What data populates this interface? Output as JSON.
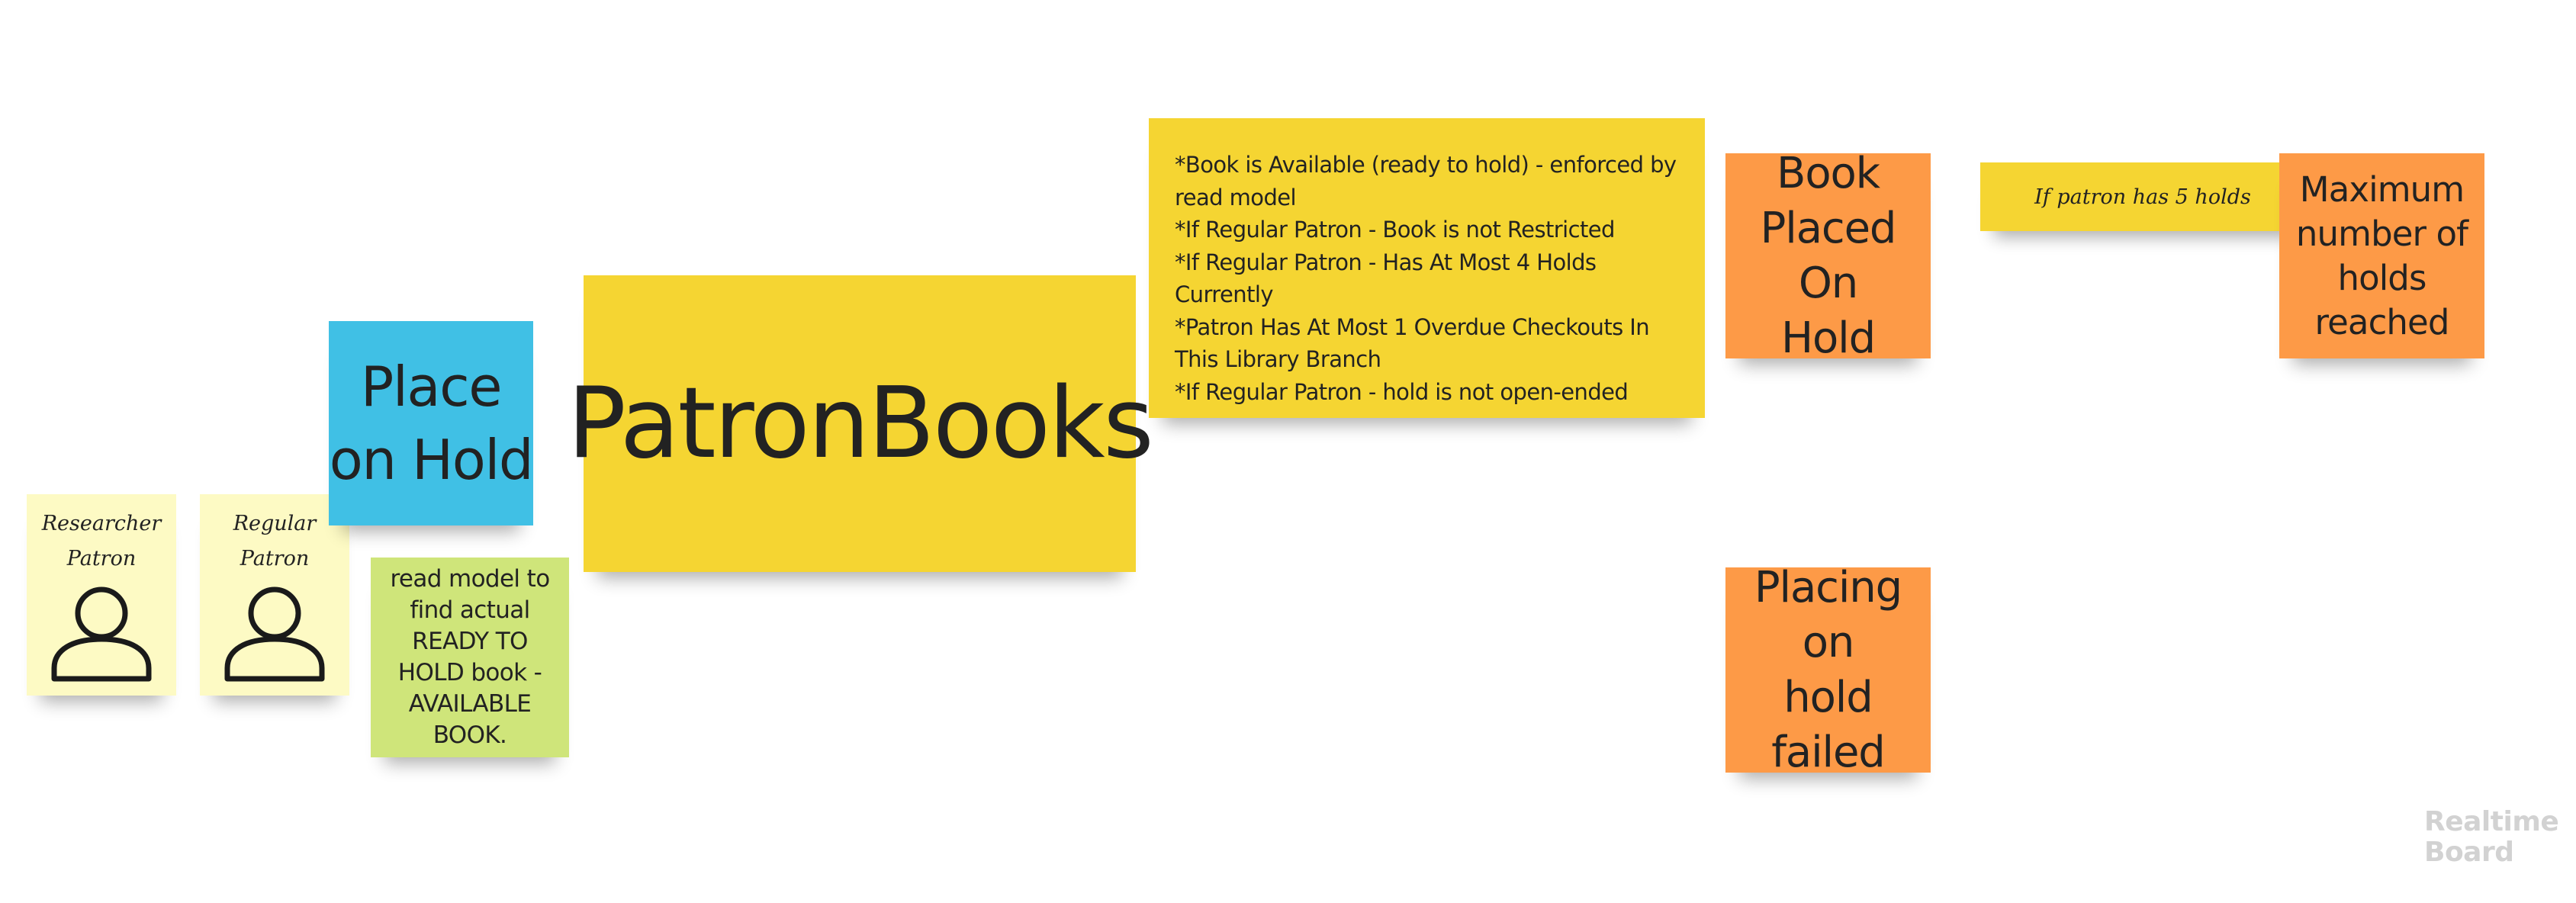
{
  "board": {
    "notes": {
      "researcher_patron": {
        "label": "Researcher\nPatron",
        "icon": "person-icon",
        "color": "#fdfac4"
      },
      "regular_patron": {
        "label": "Regular\nPatron",
        "icon": "person-icon",
        "color": "#fdfac4"
      },
      "place_on_hold": {
        "text": "Place\non Hold",
        "color": "#40c0e5"
      },
      "read_model": {
        "text": "read model to find actual READY TO HOLD book - AVAILABLE BOOK.",
        "color": "#cfe57a"
      },
      "patron_books": {
        "text": "PatronBooks",
        "color": "#f5d532"
      },
      "invariants": {
        "text": "*Book is Available (ready to hold) - enforced by read model\n*If Regular Patron - Book is not Restricted\n*If Regular Patron - Has At Most 4 Holds Currently\n*Patron Has At Most 1 Overdue Checkouts In This Library Branch\n*If Regular Patron - hold is not open-ended",
        "color": "#f5d532"
      },
      "book_placed_on_hold": {
        "text": "Book\nPlaced On\nHold",
        "color": "#fd9a47"
      },
      "policy": {
        "text": "If patron has 5 holds",
        "color": "#f5d532"
      },
      "max_holds_reached": {
        "text": "Maximum\nnumber of\nholds reached",
        "color": "#fd9a47"
      },
      "placing_on_hold_failed": {
        "text": "Placing on\nhold failed",
        "color": "#fd9a47"
      }
    },
    "watermark": {
      "line1": "Realtime",
      "line2": "Board"
    }
  }
}
